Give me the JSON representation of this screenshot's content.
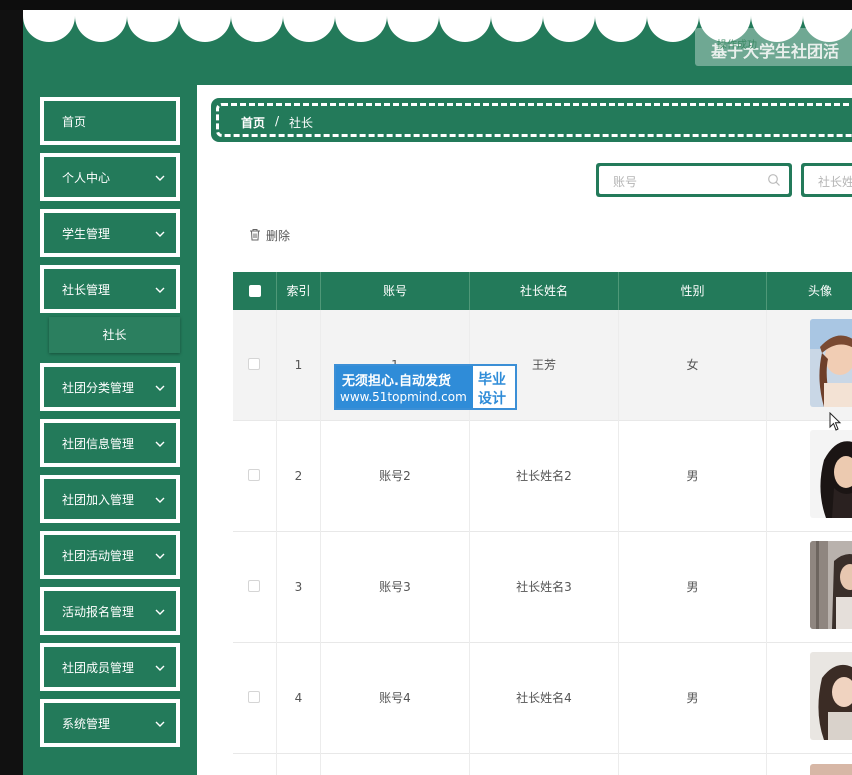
{
  "header": {
    "site_title": "基于大学生社团活",
    "tip": "操作成功"
  },
  "sidebar": {
    "items": [
      {
        "label": "首页",
        "has_chevron": false
      },
      {
        "label": "个人中心",
        "has_chevron": true
      },
      {
        "label": "学生管理",
        "has_chevron": true
      },
      {
        "label": "社长管理",
        "has_chevron": true
      },
      {
        "label": "社团分类管理",
        "has_chevron": true
      },
      {
        "label": "社团信息管理",
        "has_chevron": true
      },
      {
        "label": "社团加入管理",
        "has_chevron": true
      },
      {
        "label": "社团活动管理",
        "has_chevron": true
      },
      {
        "label": "活动报名管理",
        "has_chevron": true
      },
      {
        "label": "社团成员管理",
        "has_chevron": true
      },
      {
        "label": "系统管理",
        "has_chevron": true
      }
    ],
    "sub_item": "社长"
  },
  "breadcrumb": {
    "home": "首页",
    "separator": "/",
    "current": "社长"
  },
  "search": {
    "account_placeholder": "账号",
    "name_placeholder": "社长姓名"
  },
  "toolbar": {
    "delete_label": "删除"
  },
  "table": {
    "headers": [
      "索引",
      "账号",
      "社长姓名",
      "性别",
      "头像"
    ],
    "rows": [
      {
        "index": "1",
        "account": "1",
        "name": "王芳",
        "gender": "女"
      },
      {
        "index": "2",
        "account": "账号2",
        "name": "社长姓名2",
        "gender": "男"
      },
      {
        "index": "3",
        "account": "账号3",
        "name": "社长姓名3",
        "gender": "男"
      },
      {
        "index": "4",
        "account": "账号4",
        "name": "社长姓名4",
        "gender": "男"
      }
    ]
  },
  "watermark": {
    "line1": "无须担心.自动发货",
    "line2": "www.51topmind.com",
    "right1": "毕业",
    "right2": "设计"
  },
  "colors": {
    "primary": "#237a5a",
    "watermark_blue": "#2f8cd8"
  }
}
